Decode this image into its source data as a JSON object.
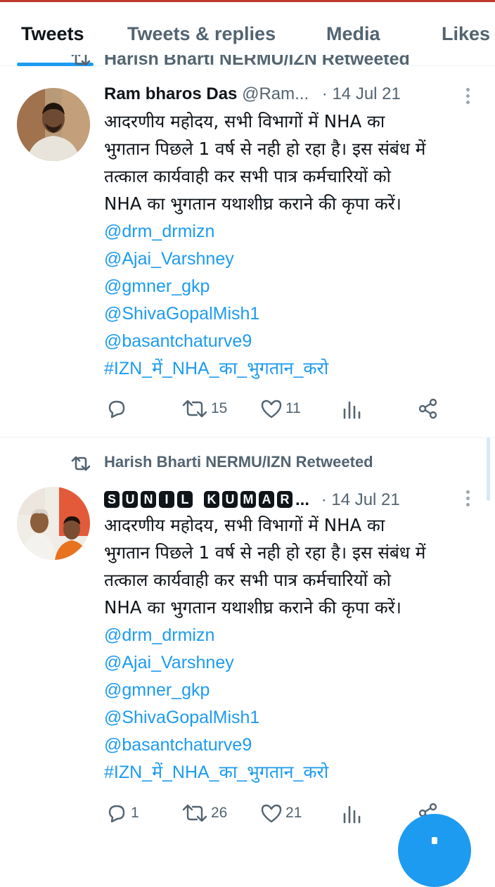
{
  "tabs": [
    {
      "label": "Tweets",
      "active": true
    },
    {
      "label": "Tweets & replies",
      "active": false
    },
    {
      "label": "Media",
      "active": false
    },
    {
      "label": "Likes",
      "active": false
    }
  ],
  "cut_header": {
    "text": "Harish Bharti NERMU/IZN Retweeted"
  },
  "tweets": [
    {
      "name": "Ram bharos Das",
      "handle": "@Ram...",
      "date": "· 14 Jul 21",
      "lines": [
        "आदरणीय महोदय, सभी विभागों में NHA का",
        "भुगतान पिछले 1 वर्ष से नही हो रहा है। इस संबंध में",
        "तत्काल कार्यवाही कर सभी पात्र कर्मचारियों को",
        "NHA का भुगतान यथाशीघ्र कराने की कृपा करें।"
      ],
      "links": [
        "@drm_drmizn",
        "@Ajai_Varshney",
        "@gmner_gkp",
        "@ShivaGopalMish1",
        "@basantchaturve9",
        "#IZN_में_NHA_का_भुगतान_करो"
      ],
      "stats": {
        "replies": "",
        "retweets": "15",
        "likes": "11"
      }
    },
    {
      "retweet_header": "Harish Bharti NERMU/IZN Retweeted",
      "name_letters": [
        "S",
        "U",
        "N",
        "I",
        "L",
        " ",
        "K",
        "U",
        "M",
        "A",
        "R"
      ],
      "name_ellipsis": "...",
      "date": "· 14 Jul 21",
      "lines": [
        "आदरणीय महोदय, सभी विभागों में NHA का",
        "भुगतान पिछले 1 वर्ष से नही हो रहा है। इस संबंध में",
        "तत्काल कार्यवाही कर सभी पात्र कर्मचारियों को",
        "NHA का भुगतान यथाशीघ्र कराने की कृपा करें।"
      ],
      "links": [
        "@drm_drmizn",
        "@Ajai_Varshney",
        "@gmner_gkp",
        "@ShivaGopalMish1",
        "@basantchaturve9",
        "#IZN_में_NHA_का_भुगतान_करो"
      ],
      "stats": {
        "replies": "1",
        "retweets": "26",
        "likes": "21"
      }
    }
  ],
  "colors": {
    "accent": "#1d9bf0",
    "secondary_text": "#536471",
    "primary_text": "#0f1419"
  }
}
